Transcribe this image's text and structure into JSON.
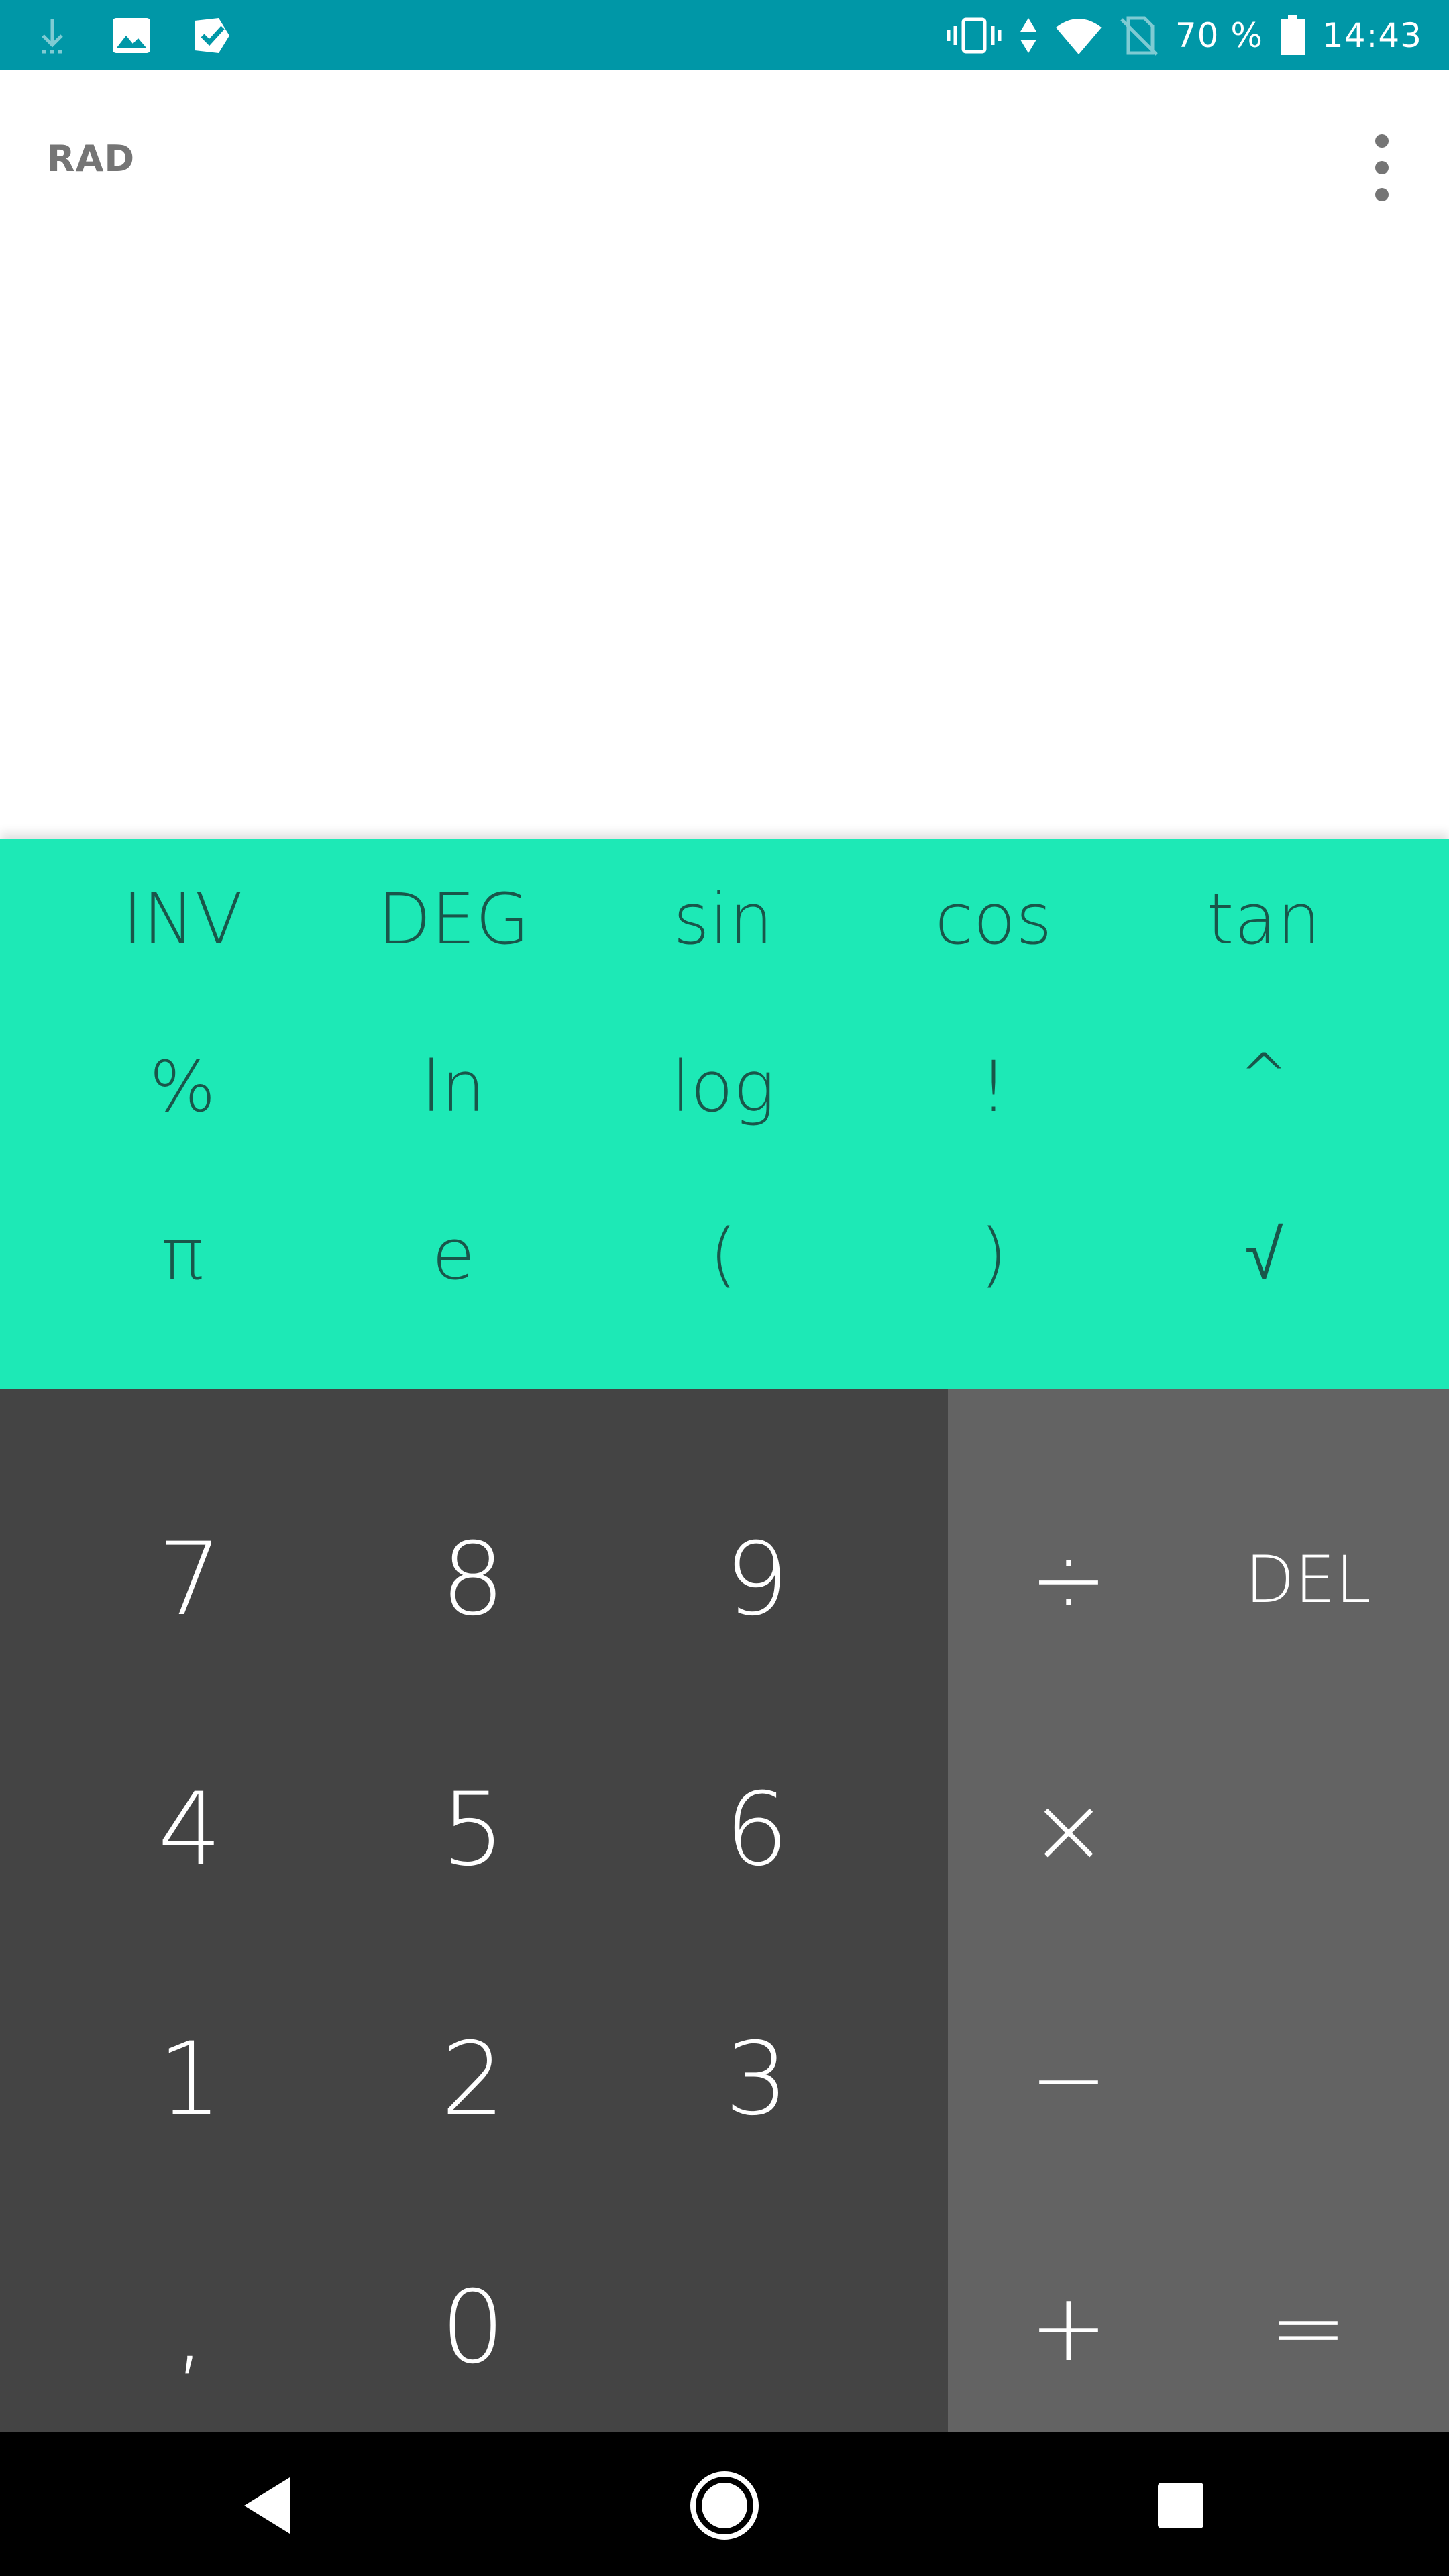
{
  "status_bar": {
    "battery_text": "70 %",
    "time": "14:43",
    "icons": [
      "download-icon",
      "image-icon",
      "play-store-icon",
      "vibrate-icon",
      "data-arrows-icon",
      "wifi-icon",
      "no-sim-icon",
      "battery-icon"
    ]
  },
  "display": {
    "angle_mode": "RAD",
    "menu_icon": "more-vert-icon"
  },
  "advanced_pad": {
    "row1": [
      "INV",
      "DEG",
      "sin",
      "cos",
      "tan"
    ],
    "row2": [
      "%",
      "ln",
      "log",
      "!",
      "^"
    ],
    "row3": [
      "π",
      "e",
      "(",
      ")",
      "√"
    ]
  },
  "numeric_pad": {
    "row1": [
      "7",
      "8",
      "9"
    ],
    "row2": [
      "4",
      "5",
      "6"
    ],
    "row3": [
      "1",
      "2",
      "3"
    ],
    "row4": [
      ",",
      "0"
    ]
  },
  "operator_pad": {
    "divide": "÷",
    "delete": "DEL",
    "multiply": "×",
    "minus": "−",
    "plus": "+",
    "equals": "="
  },
  "nav_bar": {
    "icons": [
      "back-icon",
      "home-icon",
      "recents-icon"
    ]
  },
  "colors": {
    "status_bar": "#0097a7",
    "advanced_pad": "#1de9b6",
    "advanced_text": "#19564a",
    "numeric_pad": "#444444",
    "operator_pad": "#636363"
  }
}
